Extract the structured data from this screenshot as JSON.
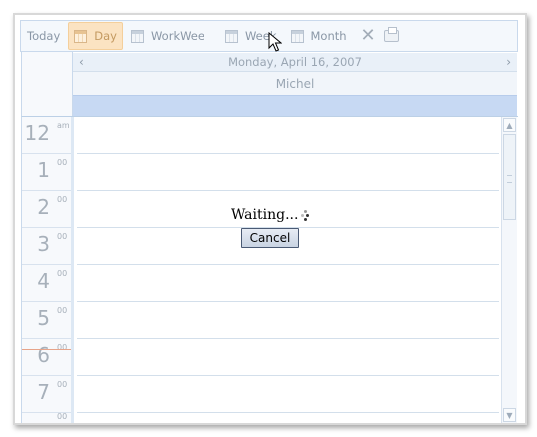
{
  "toolbar": {
    "today_label": "Today",
    "day_label": "Day",
    "workweek_label": "WorkWeek",
    "week_label": "Week",
    "month_label": "Month",
    "delete_icon": "close-icon",
    "print_icon": "print-icon",
    "view_icon": "calendar-icon"
  },
  "header": {
    "date": "Monday, April 16, 2007",
    "prev_icon": "chevron-left-icon",
    "next_icon": "chevron-right-icon",
    "resource": "Michel"
  },
  "hours": [
    {
      "num": "12",
      "sfx": "am"
    },
    {
      "num": "1",
      "sfx": "00"
    },
    {
      "num": "2",
      "sfx": "00"
    },
    {
      "num": "3",
      "sfx": "00"
    },
    {
      "num": "4",
      "sfx": "00"
    },
    {
      "num": "5",
      "sfx": "00"
    },
    {
      "num": "6",
      "sfx": "00"
    },
    {
      "num": "7",
      "sfx": "00"
    },
    {
      "num": "",
      "sfx": "00"
    }
  ],
  "dialog": {
    "waiting_text": "Waiting...",
    "cancel_label": "Cancel"
  },
  "colors": {
    "allday_bar": "#c7d9f3",
    "selected_view": "#fbe3c2",
    "current_time_line": "#e7a48a"
  }
}
